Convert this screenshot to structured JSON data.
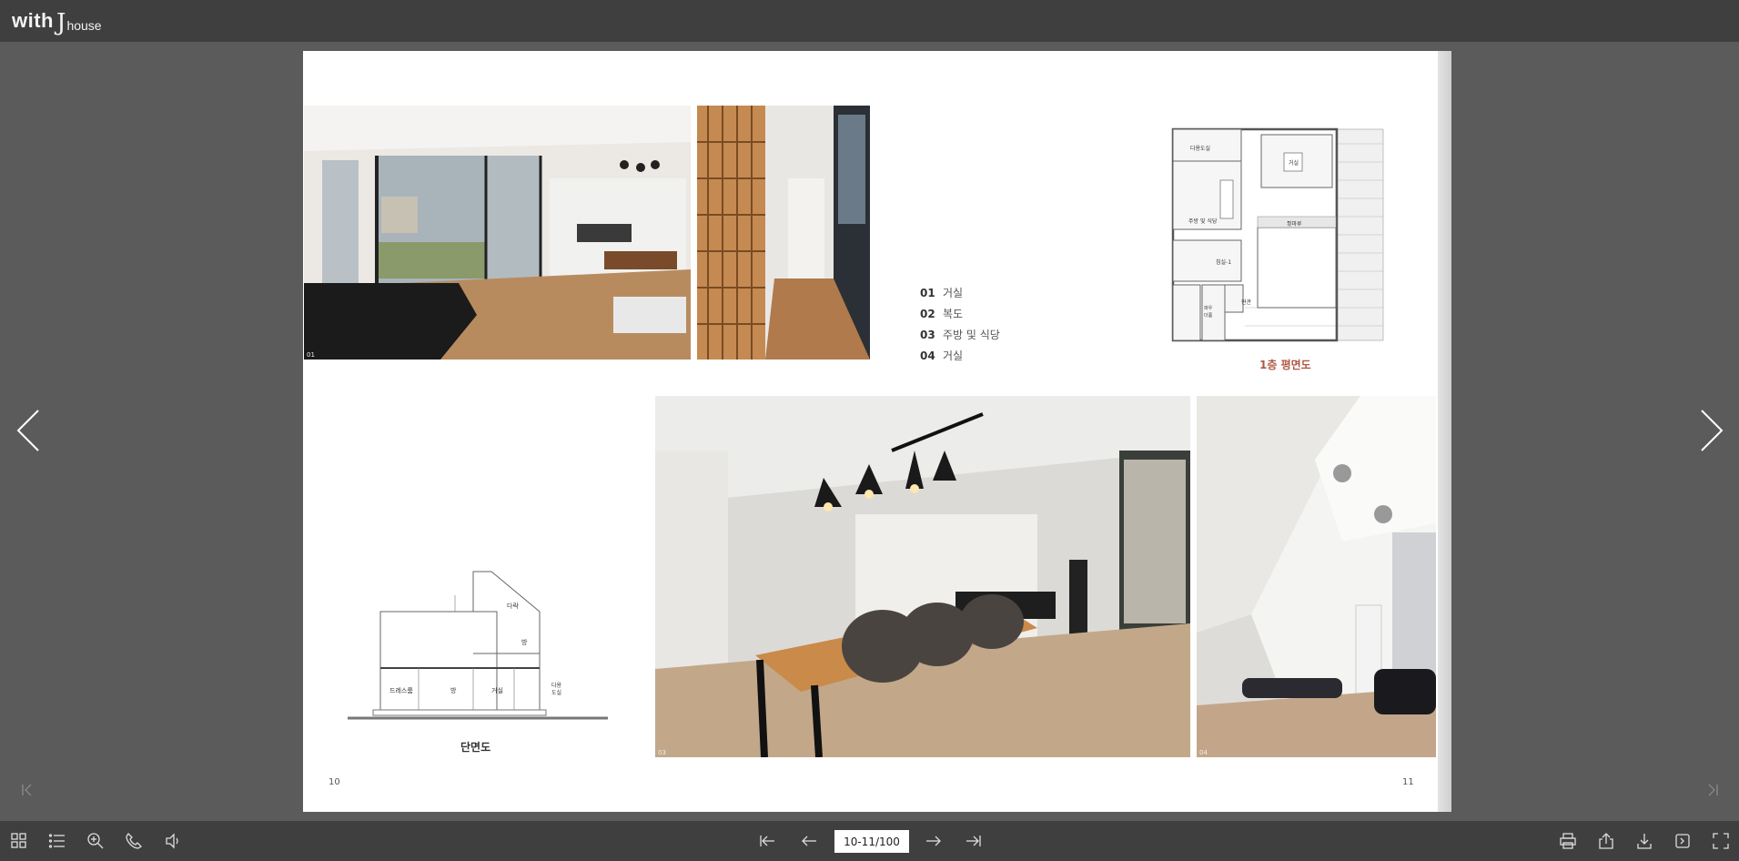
{
  "header": {
    "logo_with": "with",
    "logo_j": "J",
    "logo_house": "house"
  },
  "left_page": {
    "page_number": "10",
    "section_caption": "단면도",
    "section_labels": {
      "attic": "다락",
      "room_upper": "방",
      "dressroom": "드레스룸",
      "room_lower": "방",
      "living": "거실",
      "multi": "다용\n도실"
    },
    "photo_01_label": "01"
  },
  "right_page": {
    "page_number": "11",
    "legend": [
      {
        "num": "01",
        "label": "거실"
      },
      {
        "num": "02",
        "label": "복도"
      },
      {
        "num": "03",
        "label": "주방 및 식당"
      },
      {
        "num": "04",
        "label": "거실"
      }
    ],
    "plan_caption": "1층 평면도",
    "plan_labels": {
      "utility": "다용도실",
      "living": "거실",
      "kitchen": "주방 및 식당",
      "deck": "툇마루",
      "bedroom": "침실-1",
      "bath": "파우더룸",
      "entry": "현관"
    },
    "photo_03_label": "03",
    "photo_04_label": "04"
  },
  "toolbar": {
    "page_indicator": "10-11/100"
  },
  "icons": {
    "thumbnails": "grid-icon",
    "toc": "list-icon",
    "zoom": "zoom-icon",
    "call": "phone-icon",
    "sound": "speaker-icon",
    "first": "first-page-icon",
    "prev": "prev-page-icon",
    "next": "next-page-icon",
    "last": "last-page-icon",
    "print": "print-icon",
    "share": "share-icon",
    "download": "download-icon",
    "export": "export-icon",
    "fullscreen": "fullscreen-icon"
  }
}
